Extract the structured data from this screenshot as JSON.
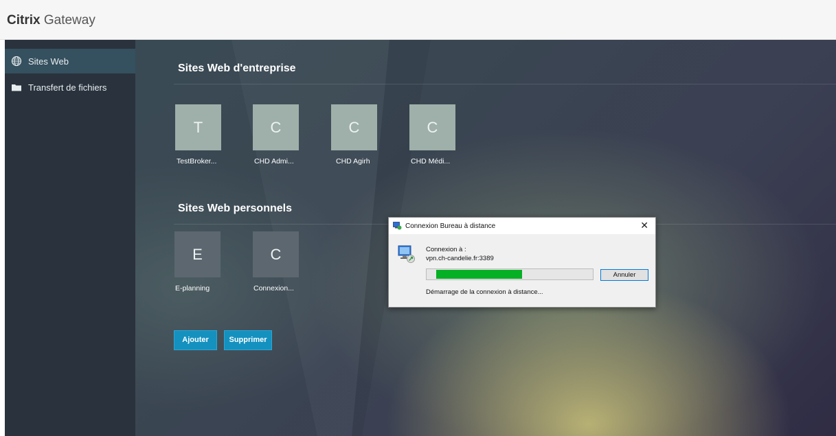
{
  "header": {
    "brand_bold": "Citrix",
    "brand_light": "Gateway"
  },
  "sidebar": {
    "items": [
      {
        "label": "Sites Web",
        "icon": "globe-icon",
        "active": true
      },
      {
        "label": "Transfert de fichiers",
        "icon": "folder-icon",
        "active": false
      }
    ]
  },
  "main": {
    "enterprise": {
      "title": "Sites Web d'entreprise",
      "tiles": [
        {
          "letter": "T",
          "label": "TestBroker..."
        },
        {
          "letter": "C",
          "label": "CHD Admi..."
        },
        {
          "letter": "C",
          "label": "CHD Agirh"
        },
        {
          "letter": "C",
          "label": "CHD Médi..."
        }
      ]
    },
    "personal": {
      "title": "Sites Web personnels",
      "tiles": [
        {
          "letter": "E",
          "label": "E-planning"
        },
        {
          "letter": "C",
          "label": "Connexion..."
        }
      ]
    },
    "buttons": {
      "add": "Ajouter",
      "delete": "Supprimer"
    }
  },
  "dialog": {
    "title": "Connexion Bureau à distance",
    "close": "✕",
    "connecting_label": "Connexion à :",
    "host": "vpn.ch-candelie.fr:3389",
    "progress": 0.55,
    "cancel_label": "Annuler",
    "status": "Démarrage de la connexion à distance..."
  },
  "colors": {
    "accent": "#1591bf",
    "progress": "#06b025",
    "sidebar": "#2a323d"
  }
}
